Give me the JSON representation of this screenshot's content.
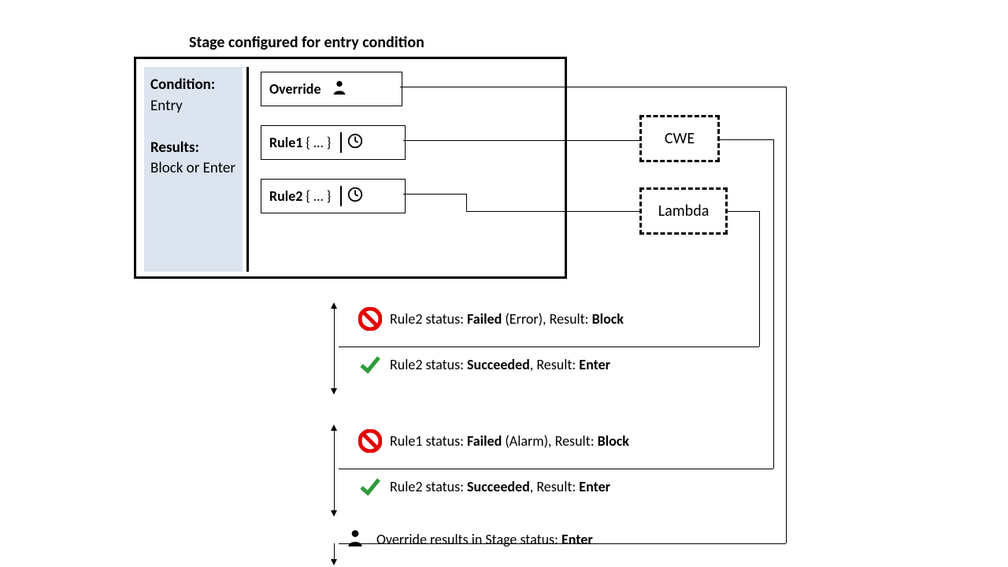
{
  "title": "Stage configured for entry condition",
  "sidebar": {
    "condition_label": "Condition:",
    "condition_value": "Entry",
    "results_label": "Results:",
    "results_value": "Block or Enter"
  },
  "rules": {
    "override_label": "Override",
    "rule1_name": "Rule1",
    "rule1_body": "{ … }",
    "rule2_name": "Rule2",
    "rule2_body": "{ … }"
  },
  "services": {
    "cwe": "CWE",
    "lambda": "Lambda"
  },
  "statuses": {
    "r2_fail_prefix": "Rule2 status: ",
    "r2_fail_status": "Failed",
    "r2_fail_detail": " (Error), Result: ",
    "r2_fail_result": "Block",
    "r2_ok_prefix": "Rule2 status: ",
    "r2_ok_status": "Succeeded",
    "r2_ok_mid": ", Result: ",
    "r2_ok_result": "Enter",
    "r1_fail_prefix": "Rule1 status: ",
    "r1_fail_status": "Failed",
    "r1_fail_detail": " (Alarm), Result: ",
    "r1_fail_result": "Block",
    "r1b_ok_prefix": "Rule2 status: ",
    "r1b_ok_status": "Succeeded",
    "r1b_ok_mid": ", Result: ",
    "r1b_ok_result": "Enter",
    "override_text": "Override results in Stage status: ",
    "override_result": "Enter"
  }
}
